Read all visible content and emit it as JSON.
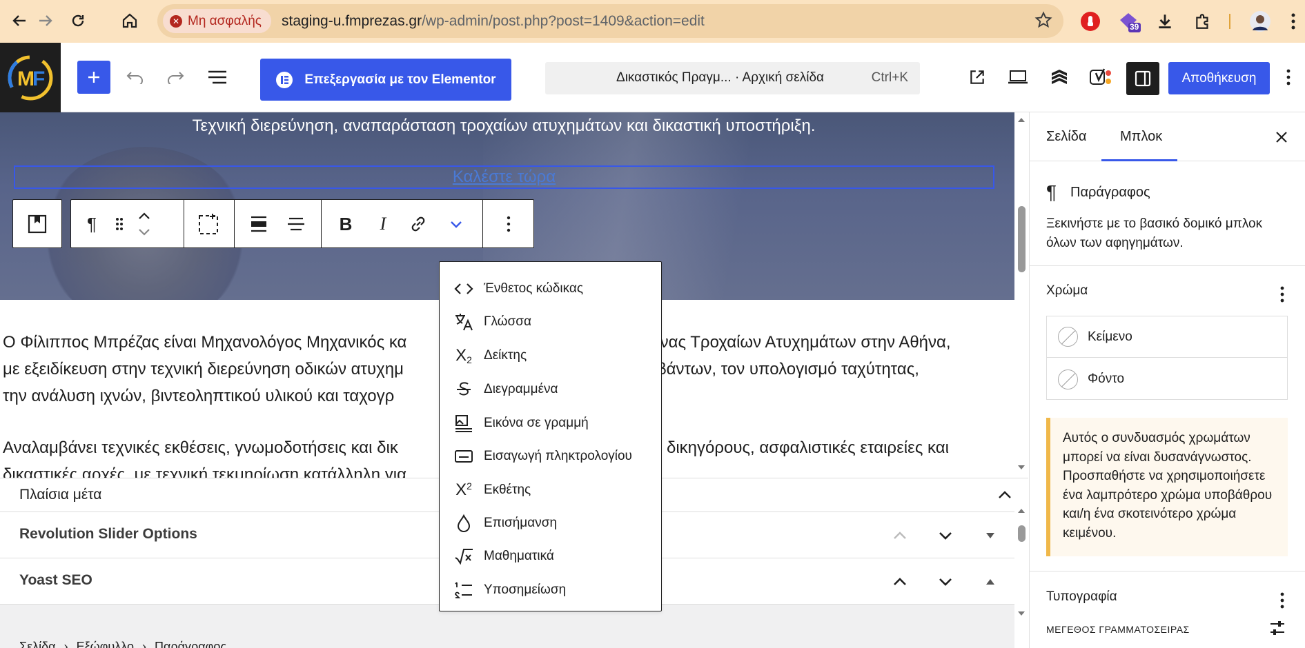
{
  "browser": {
    "security_label": "Μη ασφαλής",
    "url_host": "staging-u.fmprezas.gr",
    "url_path": "/wp-admin/post.php?post=1409&action=edit",
    "ext_badge": "39"
  },
  "header": {
    "elementor_label": "Επεξεργασία με τον Elementor",
    "doc_title": "Δικαστικός Πραγμ...  · Αρχική σελίδα",
    "shortcut": "Ctrl+K",
    "save_label": "Αποθήκευση",
    "accent": "#3858e9"
  },
  "canvas": {
    "hero_text": "Τεχνική διερεύνηση, αναπαράσταση τροχαίων ατυχημάτων και δικαστική υποστήριξη.",
    "cta_text": "Καλέστε τώρα",
    "para1_line1": "Ο Φίλιππος Μπρέζας είναι Μηχανολόγος Μηχανικός κα",
    "para1_line1_end": "μονας Τροχαίων Ατυχημάτων στην Αθήνα,",
    "para1_line2": "με εξειδίκευση στην τεχνική διερεύνηση οδικών ατυχημ",
    "para1_line2_end": "υμβάντων, τον υπολογισμό ταχύτητας,",
    "para1_line3": "την ανάλυση ιχνών, βιντεοληπτικού υλικού και ταχογρ",
    "para2_line1": "Αναλαμβάνει τεχνικές εκθέσεις, γνωμοδοτήσεις και δικ",
    "para2_line1_end": "τες, δικηγόρους, ασφαλιστικές εταιρείες και",
    "para2_line2": "δικαστικές αρχές, με τεχνική τεκμηρίωση κατάλληλη για"
  },
  "meta": {
    "boxes_title": "Πλαίσια μέτα",
    "revslider": "Revolution Slider Options",
    "yoast": "Yoast SEO",
    "breadcrumb": [
      "Σελίδα",
      "Εξώφυλλο",
      "Παράγραφος"
    ]
  },
  "dropdown": {
    "items": [
      {
        "label": "Ένθετος κώδικας",
        "icon": "code-icon"
      },
      {
        "label": "Γλώσσα",
        "icon": "language-icon"
      },
      {
        "label": "Δείκτης",
        "icon": "subscript-icon"
      },
      {
        "label": "Διεγραμμένα",
        "icon": "strikethrough-icon"
      },
      {
        "label": "Εικόνα σε γραμμή",
        "icon": "inline-image-icon"
      },
      {
        "label": "Εισαγωγή πληκτρολογίου",
        "icon": "keyboard-icon"
      },
      {
        "label": "Εκθέτης",
        "icon": "superscript-icon"
      },
      {
        "label": "Επισήμανση",
        "icon": "highlight-icon"
      },
      {
        "label": "Μαθηματικά",
        "icon": "math-icon"
      },
      {
        "label": "Υποσημείωση",
        "icon": "footnote-icon"
      }
    ]
  },
  "sidebar": {
    "tab_page": "Σελίδα",
    "tab_block": "Μπλοκ",
    "block_name": "Παράγραφος",
    "block_desc": "Ξεκινήστε με το βασικό δομικό μπλοκ όλων των αφηγημάτων.",
    "color_heading": "Χρώμα",
    "color_text": "Κείμενο",
    "color_bg": "Φόντο",
    "notice": "Αυτός ο συνδυασμός χρωμάτων μπορεί να είναι δυσανάγνωστος. Προσπαθήστε να χρησιμοποιήσετε ένα λαμπρότερο χρώμα υποβάθρου και/η ένα σκοτεινότερο χρώμα κειμένου.",
    "typography_heading": "Τυπογραφία",
    "font_size_label": "ΜΕΓΕΘΟΣ ΓΡΑΜΜΑΤΟΣΕΙΡΑΣ"
  }
}
